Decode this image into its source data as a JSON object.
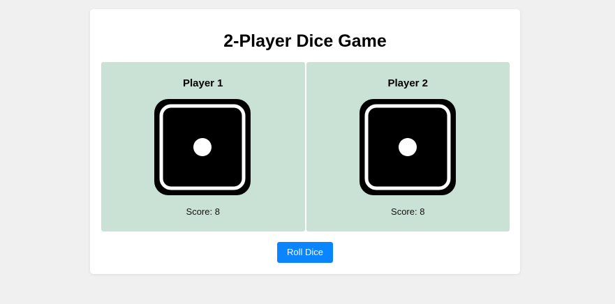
{
  "game": {
    "title": "2-Player Dice Game",
    "roll_button_label": "Roll Dice"
  },
  "players": [
    {
      "name": "Player 1",
      "score_label": "Score:",
      "score": "8",
      "die_face": 1,
      "die_icon": "dice-one-icon"
    },
    {
      "name": "Player 2",
      "score_label": "Score:",
      "score": "8",
      "die_face": 1,
      "die_icon": "dice-one-icon"
    }
  ],
  "colors": {
    "page_background": "#f0f0f0",
    "card_background": "#ffffff",
    "player_panel": "#cae1d5",
    "button": "#0a84ff",
    "die_face": "#000000",
    "die_pip": "#ffffff"
  }
}
